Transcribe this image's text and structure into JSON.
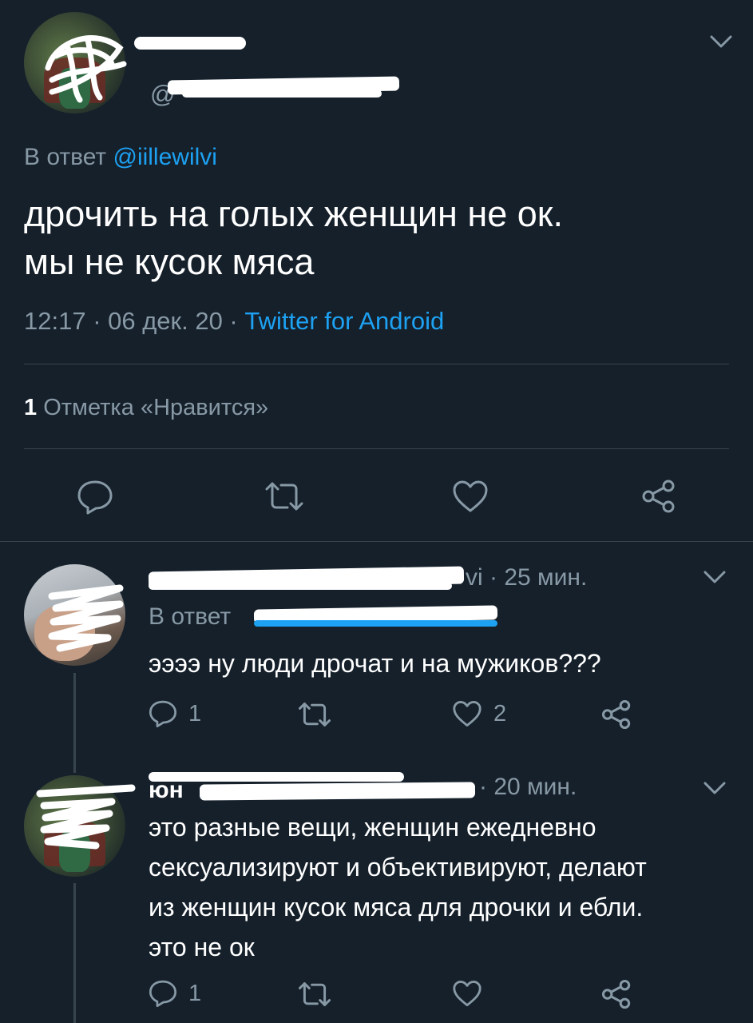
{
  "main_tweet": {
    "reply_prefix": "В ответ",
    "reply_handle": "@iillewilvi",
    "text_line1": "дрочить на голых женщин не ок.",
    "text_line2": "мы не кусок мяса",
    "time": "12:17 · 06 дек. 20 ·",
    "source": "Twitter for Android",
    "likes_count": "1",
    "likes_label": "Отметка «Нравится»",
    "handle_fragment": "@"
  },
  "replies": [
    {
      "name_fragment": "vi",
      "time": "· 25 мин.",
      "reply_prefix": "В ответ",
      "text_lines": [
        "ээээ ну люди дрочат и на мужиков???"
      ],
      "reply_count": "1",
      "retweet_count": "",
      "like_count": "2"
    },
    {
      "name_fragment": "юн",
      "time": "· 20 мин.",
      "text_lines": [
        "это разные вещи, женщин ежедневно",
        "сексуализируют и объективируют, делают",
        "из женщин кусок мяса для дрочки и ебли.",
        "это не ок"
      ],
      "reply_count": "1",
      "retweet_count": "",
      "like_count": ""
    }
  ],
  "colors": {
    "background": "#15202b",
    "muted": "#8899a6",
    "link": "#1da1f2",
    "divider": "#38444d"
  },
  "icons": [
    "chevron-down-icon",
    "reply-icon",
    "retweet-icon",
    "like-icon",
    "share-icon"
  ]
}
